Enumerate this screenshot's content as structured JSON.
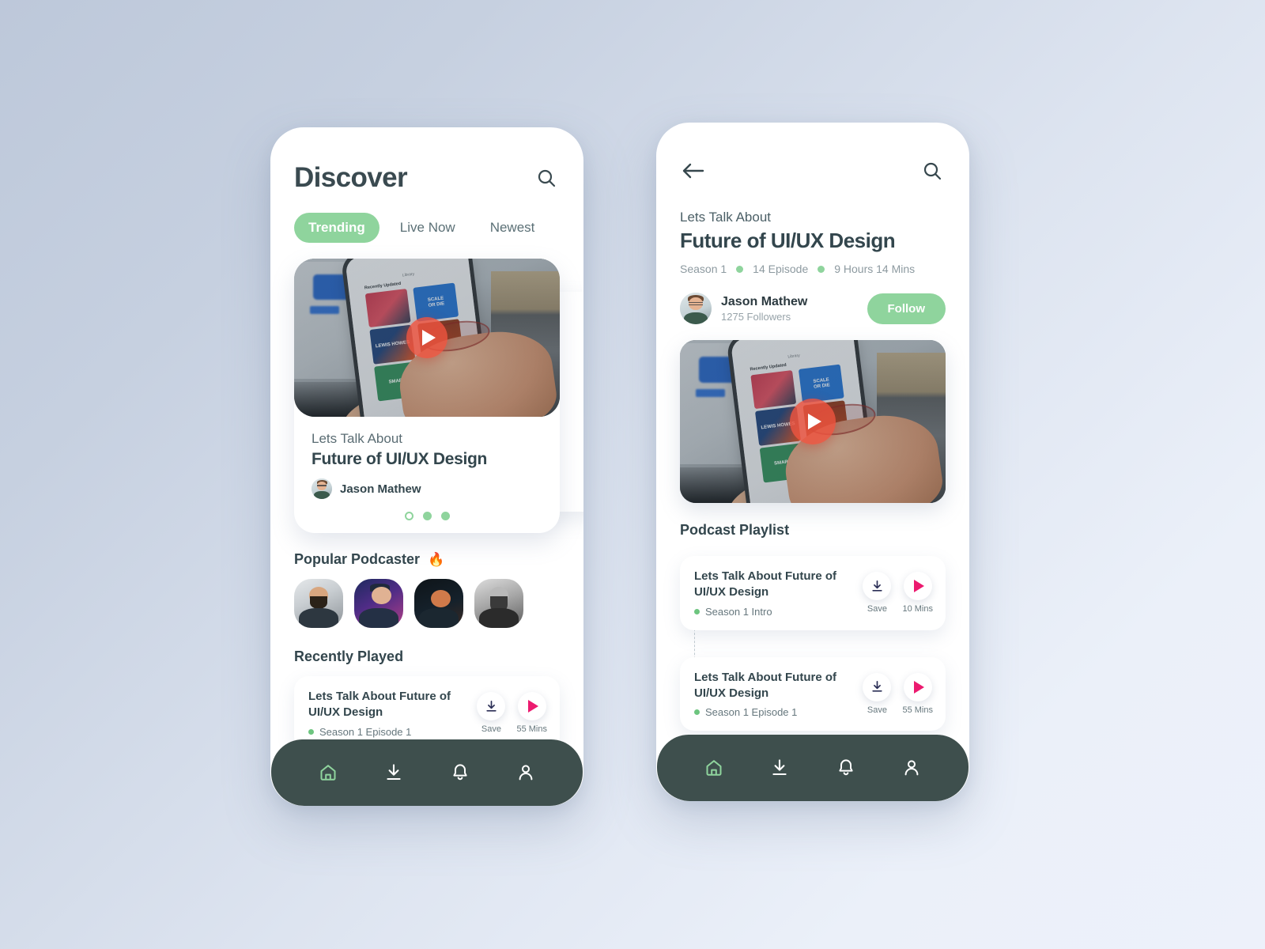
{
  "theme": {
    "accent_green": "#8fd49d",
    "dark_nav": "#3e4f4d",
    "text_dark": "#33464d",
    "text_muted": "#66777d",
    "play_pink": "#ec1a6f",
    "play_red": "#ef533e",
    "page_bg_from": "#bdc8da",
    "page_bg_to": "#edf1fa"
  },
  "discover": {
    "title": "Discover",
    "search_icon": "search-icon",
    "tabs": [
      {
        "label": "Trending",
        "active": true
      },
      {
        "label": "Live Now",
        "active": false
      },
      {
        "label": "Newest",
        "active": false
      }
    ],
    "hero": {
      "play_icon": "play-icon",
      "subtitle": "Lets Talk About",
      "title": "Future of UI/UX Design",
      "author": "Jason Mathew",
      "dots": [
        {
          "state": "ring"
        },
        {
          "state": "filled"
        },
        {
          "state": "filled"
        }
      ]
    },
    "popular": {
      "title": "Popular Podcaster",
      "emoji": "🔥",
      "podcasters": [
        {
          "name": "podcaster-1"
        },
        {
          "name": "podcaster-2"
        },
        {
          "name": "podcaster-3"
        },
        {
          "name": "podcaster-4"
        }
      ]
    },
    "recently_played": {
      "title": "Recently Played",
      "episode": {
        "title": "Lets Talk About Future of UI/UX Design",
        "meta": "Season 1 Episode 1",
        "save_label": "Save",
        "duration": "55 Mins",
        "save_icon": "download-icon",
        "play_icon": "play-icon"
      }
    },
    "nav": [
      {
        "icon": "home-icon",
        "active": true
      },
      {
        "icon": "download-icon",
        "active": false
      },
      {
        "icon": "bell-icon",
        "active": false
      },
      {
        "icon": "person-icon",
        "active": false
      }
    ]
  },
  "detail": {
    "back_icon": "back-arrow-icon",
    "search_icon": "search-icon",
    "subtitle": "Lets Talk About",
    "title": "Future of UI/UX Design",
    "stats": {
      "season": "Season 1",
      "episodes": "14 Episode",
      "duration": "9 Hours 14 Mins"
    },
    "creator": {
      "name": "Jason Mathew",
      "followers": "1275 Followers",
      "follow_label": "Follow"
    },
    "hero": {
      "play_icon": "play-icon"
    },
    "playlist": {
      "title": "Podcast Playlist",
      "items": [
        {
          "title": "Lets Talk About Future of UI/UX Design",
          "meta": "Season 1 Intro",
          "save_label": "Save",
          "duration": "10 Mins",
          "save_icon": "download-icon",
          "play_icon": "play-icon"
        },
        {
          "title": "Lets Talk About Future of UI/UX Design",
          "meta": "Season 1 Episode 1",
          "save_label": "Save",
          "duration": "55 Mins",
          "save_icon": "download-icon",
          "play_icon": "play-icon"
        }
      ]
    },
    "nav": [
      {
        "icon": "home-icon",
        "active": true
      },
      {
        "icon": "download-icon",
        "active": false
      },
      {
        "icon": "bell-icon",
        "active": false
      },
      {
        "icon": "person-icon",
        "active": false
      }
    ]
  }
}
